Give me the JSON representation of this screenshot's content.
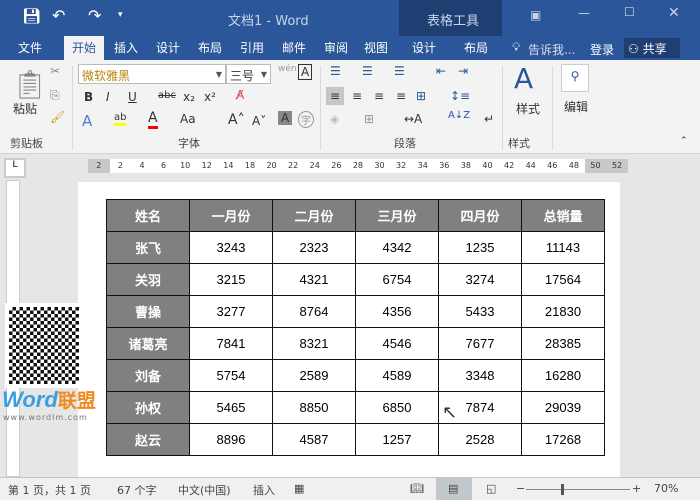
{
  "window": {
    "title": "文档1 - Word",
    "context_tab": "表格工具"
  },
  "quick_access": {
    "save_icon": "save-icon",
    "undo_icon": "undo-icon",
    "redo_icon": "redo-icon",
    "customize_icon": "chevron-down-icon"
  },
  "tabs": [
    "文件",
    "开始",
    "插入",
    "设计",
    "布局",
    "引用",
    "邮件",
    "审阅",
    "视图",
    "设计",
    "布局"
  ],
  "active_tab": "开始",
  "tell_me": "告诉我...",
  "login": "登录",
  "share": "共享",
  "ribbon": {
    "paste": "粘贴",
    "clipboard_group": "剪贴板",
    "font_name": "微软雅黑",
    "font_size": "三号",
    "font_group": "字体",
    "bold": "B",
    "italic": "I",
    "underline": "U",
    "strike": "abc",
    "sub": "x₂",
    "sup": "x²",
    "highlight_color": "#ffff00",
    "font_color": "#ff0000",
    "paragraph_group": "段落",
    "styles": "样式",
    "styles_group": "样式",
    "edit": "编辑"
  },
  "ruler": [
    "2",
    "2",
    "4",
    "6",
    "10",
    "12",
    "14",
    "18",
    "20",
    "22",
    "24",
    "26",
    "28",
    "30",
    "32",
    "34",
    "36",
    "38",
    "40",
    "42",
    "44",
    "46",
    "48",
    "50",
    "52"
  ],
  "table": {
    "headers": [
      "姓名",
      "一月份",
      "二月份",
      "三月份",
      "四月份",
      "总销量"
    ],
    "rows": [
      [
        "张飞",
        "3243",
        "2323",
        "4342",
        "1235",
        "11143"
      ],
      [
        "关羽",
        "3215",
        "4321",
        "6754",
        "3274",
        "17564"
      ],
      [
        "曹操",
        "3277",
        "8764",
        "4356",
        "5433",
        "21830"
      ],
      [
        "诸葛亮",
        "7841",
        "8321",
        "4546",
        "7677",
        "28385"
      ],
      [
        "刘备",
        "5754",
        "2589",
        "4589",
        "3348",
        "16280"
      ],
      [
        "孙权",
        "5465",
        "8850",
        "6850",
        "7874",
        "29039"
      ],
      [
        "赵云",
        "8896",
        "4587",
        "1257",
        "2528",
        "17268"
      ]
    ]
  },
  "watermark": {
    "logo": "Word联盟",
    "url": "www.wordlm.com"
  },
  "status": {
    "page": "第 1 页，共 1 页",
    "words": "67 个字",
    "language": "中文(中国)",
    "mode": "插入",
    "zoom": "70%",
    "zoom_level": 70
  }
}
